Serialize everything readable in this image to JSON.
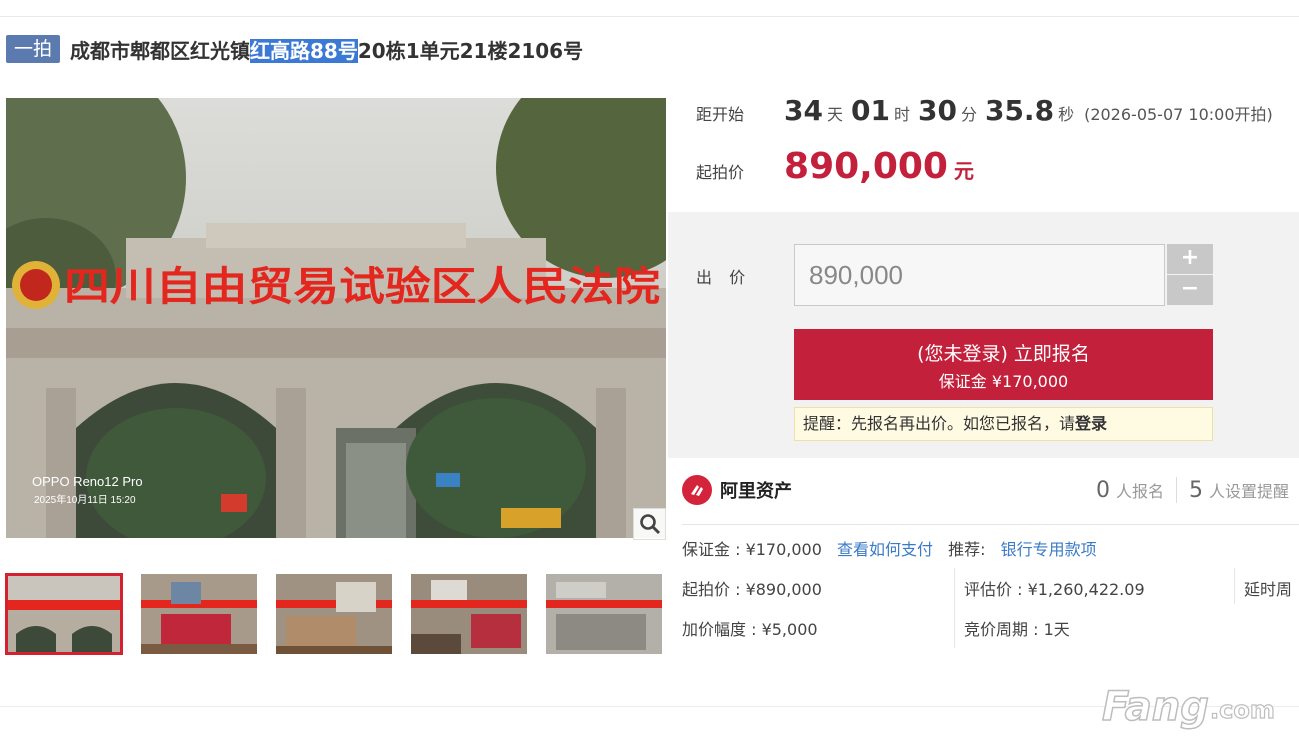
{
  "header": {
    "tag": "一拍",
    "title_prefix": "成都市郫都区红光镇",
    "title_highlight": "红高路88号",
    "title_suffix": "20栋1单元21楼2106号"
  },
  "photo": {
    "sign_text": "四川自由贸易试验区人民法院",
    "camera_brand": "OPPO Reno12 Pro",
    "photo_timestamp": "2025年10月11日 15:20",
    "thumbnail_count": 5
  },
  "countdown": {
    "label": "距开始",
    "days": "34",
    "days_unit": "天",
    "hours": "01",
    "hours_unit": "时",
    "minutes": "30",
    "minutes_unit": "分",
    "seconds": "35.8",
    "seconds_unit": "秒",
    "start_note": "(2026-05-07 10:00开拍)"
  },
  "start_price": {
    "label": "起拍价",
    "value": "890,000",
    "unit": "元"
  },
  "bid": {
    "label": "出 价",
    "input_value": "890,000",
    "plus": "+",
    "minus": "−",
    "signup_main": "(您未登录) 立即报名",
    "signup_sub": "保证金 ¥170,000",
    "notice_text": "提醒：先报名再出价。如您已报名，请",
    "notice_link": "登录"
  },
  "platform": {
    "name": "阿里资产",
    "signup_count": "0",
    "signup_text": "人报名",
    "reminder_count": "5",
    "reminder_text": "人设置提醒"
  },
  "details": {
    "deposit": "保证金 : ¥170,000",
    "how_to_pay": "查看如何支付",
    "recommend_label": "推荐:",
    "recommend_link": "银行专用款项",
    "start_price": "起拍价 : ¥890,000",
    "appraisal": "评估价 : ¥1,260,422.09",
    "delay": "延时周",
    "increment": "加价幅度 : ¥5,000",
    "period": "竞价周期 : 1天"
  },
  "colors": {
    "accent_red": "#c3203b",
    "tag_blue": "#5b7bb0",
    "link_blue": "#3a7bc8",
    "highlight_blue": "#3c79d4"
  }
}
